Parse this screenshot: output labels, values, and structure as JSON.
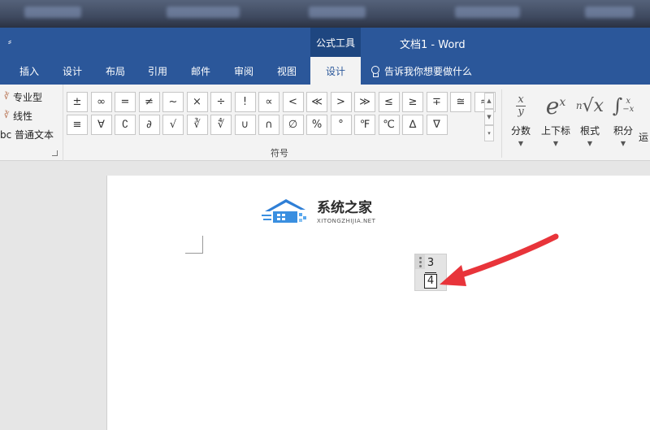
{
  "title_bar": {
    "quick_access": "⸗",
    "context_group": "公式工具",
    "doc_title": "文档1 - Word"
  },
  "tabs": [
    {
      "label": "插入"
    },
    {
      "label": "设计"
    },
    {
      "label": "布局"
    },
    {
      "label": "引用"
    },
    {
      "label": "邮件"
    },
    {
      "label": "审阅"
    },
    {
      "label": "视图"
    },
    {
      "label": "设计",
      "active": true
    }
  ],
  "tell_me": "告诉我你想要做什么",
  "tools": {
    "professional": "专业型",
    "linear": "线性",
    "normal_text": "bc 普通文本"
  },
  "symbols": {
    "row1": [
      "±",
      "∞",
      "=",
      "≠",
      "~",
      "×",
      "÷",
      "!",
      "∝",
      "<",
      "≪",
      ">",
      "≫",
      "≤",
      "≥",
      "∓",
      "≅"
    ],
    "row2": [
      "≈",
      "≡",
      "∀",
      "∁",
      "∂",
      "√",
      "∛",
      "∜",
      "∪",
      "∩",
      "∅",
      "%",
      "°",
      "℉",
      "℃",
      "∆",
      "∇"
    ],
    "group_label": "符号"
  },
  "structures": [
    {
      "label": "分数",
      "icon": "fraction-icon"
    },
    {
      "label": "上下标",
      "icon": "script-icon"
    },
    {
      "label": "根式",
      "icon": "radical-icon"
    },
    {
      "label": "积分",
      "icon": "integral-icon"
    },
    {
      "label": "运",
      "icon": "operator-icon"
    }
  ],
  "watermark": {
    "title": "系统之家",
    "subtitle": "XITONGZHIJIA.NET"
  },
  "equation": {
    "numerator": "3",
    "denominator": "4"
  },
  "colors": {
    "titlebar": "#2b579a",
    "ribbon": "#f3f3f3",
    "arrow": "#e8343a"
  }
}
